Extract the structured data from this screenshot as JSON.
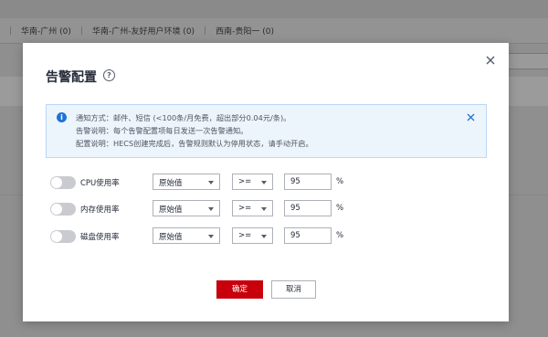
{
  "background": {
    "tabs": [
      "华南-广州 (0)",
      "华南-广州-友好用户环境 (0)",
      "西南-贵阳一 (0)"
    ]
  },
  "dialog": {
    "title": "告警配置",
    "help_icon": "?",
    "close_icon": "close-icon",
    "info": {
      "lines": [
        "通知方式：邮件、短信 (<100条/月免费，超出部分0.04元/条)。",
        "告警说明：每个告警配置项每日发送一次告警通知。",
        "配置说明：HECS创建完成后，告警规则默认为停用状态，请手动开启。"
      ]
    },
    "rules": [
      {
        "metric": "CPU使用率",
        "source": "原始值",
        "operator": ">=",
        "threshold": "95",
        "unit": "%",
        "enabled": false
      },
      {
        "metric": "内存使用率",
        "source": "原始值",
        "operator": ">=",
        "threshold": "95",
        "unit": "%",
        "enabled": false
      },
      {
        "metric": "磁盘使用率",
        "source": "原始值",
        "operator": ">=",
        "threshold": "95",
        "unit": "%",
        "enabled": false
      }
    ],
    "ok_label": "确定",
    "cancel_label": "取消"
  },
  "colors": {
    "primary": "#c7000b",
    "info_icon": "#1f73d8",
    "info_bg": "#edf5fc"
  }
}
